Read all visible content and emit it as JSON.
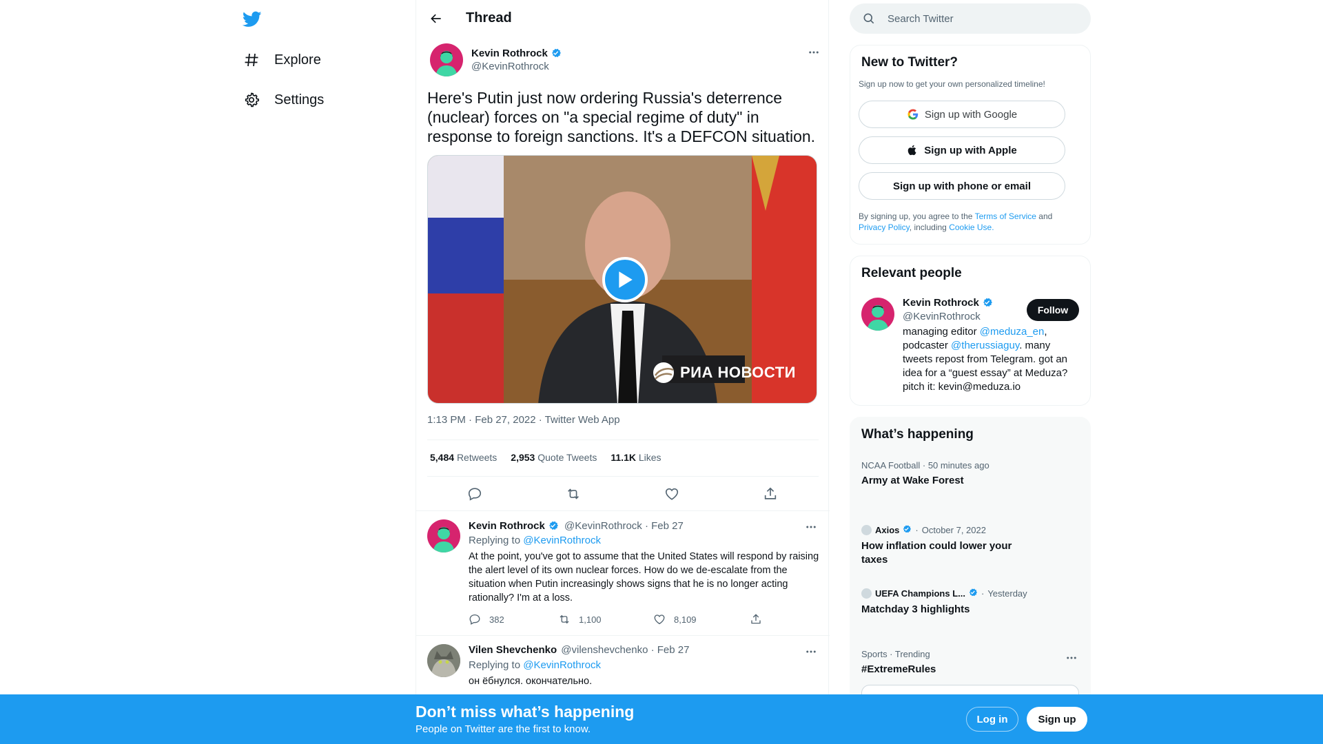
{
  "nav": {
    "logo_icon": "twitter-bird-icon",
    "items": [
      {
        "label": "Explore",
        "icon": "hashtag-icon"
      },
      {
        "label": "Settings",
        "icon": "gear-icon"
      }
    ]
  },
  "header": {
    "title": "Thread"
  },
  "main_tweet": {
    "name": "Kevin Rothrock",
    "handle": "@KevinRothrock",
    "text": "Here's Putin just now ordering Russia's deterrence (nuclear) forces on \"a special regime of duty\" in response to foreign sanctions. It's a DEFCON situation.",
    "media_watermark": "РИА НОВОСТИ",
    "timestamp": "1:13 PM · Feb 27, 2022 · Twitter Web App",
    "stats": {
      "retweets": "5,484",
      "retweets_label": "Retweets",
      "quotes": "2,953",
      "quotes_label": "Quote Tweets",
      "likes": "11.1K",
      "likes_label": "Likes"
    }
  },
  "replies": [
    {
      "name": "Kevin Rothrock",
      "handle_date": "@KevinRothrock · Feb 27",
      "replying_prefix": "Replying to",
      "replying_to": "@KevinRothrock",
      "text": "At the point, you've got to assume that the United States will respond by raising the alert level of its own nuclear forces. How do we de-escalate from the situation when Putin increasingly shows signs that he is no longer acting rationally? I'm at a loss.",
      "replies_count": "382",
      "retweets_count": "1,100",
      "likes_count": "8,109"
    },
    {
      "name": "Vilen Shevchenko",
      "handle_date": "@vilenshevchenko · Feb 27",
      "replying_prefix": "Replying to",
      "replying_to": "@KevinRothrock",
      "text": "он ёбнулся. окончательно."
    }
  ],
  "search": {
    "placeholder": "Search Twitter"
  },
  "new_to_twitter": {
    "title": "New to Twitter?",
    "note": "Sign up now to get your own personalized timeline!",
    "google_label": "Sign up with Google",
    "apple_label": "Sign up with Apple",
    "phone_label": "Sign up with phone or email",
    "terms_prefix": "By signing up, you agree to the",
    "terms_link": "Terms of Service",
    "terms_and": "and",
    "privacy_link": "Privacy Policy",
    "including": ", including",
    "cookie_link": "Cookie Use."
  },
  "relevant_people": {
    "title": "Relevant people",
    "name": "Kevin Rothrock",
    "handle": "@KevinRothrock",
    "follow_label": "Follow",
    "bio_1": "managing editor",
    "bio_link_1": "@meduza_en",
    "bio_2": ",",
    "bio_3": "podcaster",
    "bio_link_2": "@therussiaguy",
    "bio_4": ". many tweets repost from Telegram. got an idea for a “guest essay” at Meduza? pitch it: kevin@meduza.io"
  },
  "whats_happening": {
    "title": "What’s happening",
    "trends": [
      {
        "meta": "NCAA Football · 50 minutes ago",
        "title": "Army at Wake Forest"
      },
      {
        "source": "Axios",
        "meta": "October 7, 2022",
        "title": "How inflation could lower your taxes"
      },
      {
        "source": "UEFA Champions L...",
        "meta": "Yesterday",
        "title": "Matchday 3 highlights"
      },
      {
        "meta": "Sports · Trending",
        "title": "#ExtremeRules"
      }
    ]
  },
  "bottom_bar": {
    "title": "Don’t miss what’s happening",
    "subtitle": "People on Twitter are the first to know.",
    "login_label": "Log in",
    "signup_label": "Sign up"
  },
  "colors": {
    "accent": "#1d9bf0",
    "text": "#0f1419",
    "muted": "#536471"
  }
}
